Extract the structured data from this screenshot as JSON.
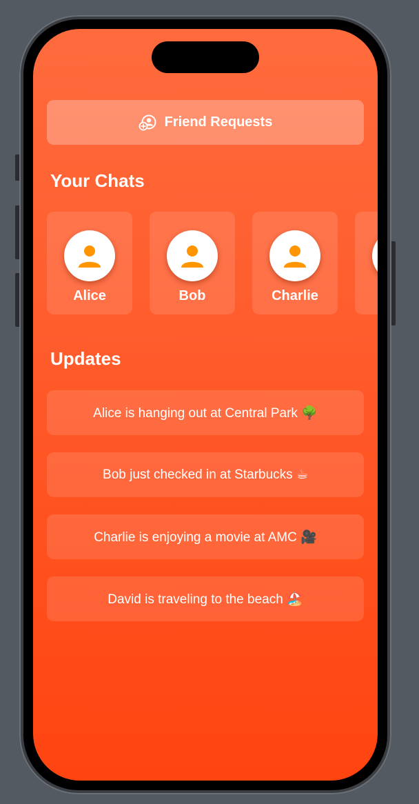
{
  "colors": {
    "background": "#545a62",
    "screen_top": "#ff6b3d",
    "screen_bottom": "#ff4410",
    "avatar_icon": "#ff9500",
    "text": "#ffffff"
  },
  "header": {
    "friend_requests_label": "Friend Requests",
    "friend_requests_icon": "person-add-icon"
  },
  "chats": {
    "title": "Your Chats",
    "items": [
      {
        "name": "Alice",
        "icon": "person-icon"
      },
      {
        "name": "Bob",
        "icon": "person-icon"
      },
      {
        "name": "Charlie",
        "icon": "person-icon"
      },
      {
        "name": "",
        "icon": "person-icon"
      }
    ]
  },
  "updates": {
    "title": "Updates",
    "items": [
      {
        "text": "Alice is hanging out at Central Park 🌳"
      },
      {
        "text": "Bob just checked in at Starbucks ☕"
      },
      {
        "text": "Charlie is enjoying a movie at AMC 🎥"
      },
      {
        "text": "David is traveling to the beach 🏖️"
      }
    ]
  }
}
